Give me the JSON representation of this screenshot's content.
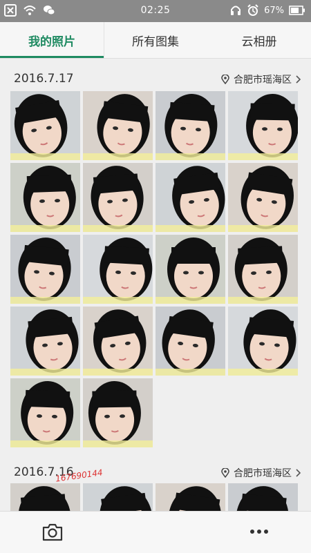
{
  "status_bar": {
    "time": "02:25",
    "battery": "67%",
    "icons_left": [
      "close-box-icon",
      "wifi-icon",
      "wechat-icon"
    ],
    "icons_right": [
      "headset-icon",
      "alarm-icon",
      "battery-icon"
    ]
  },
  "tabs": [
    {
      "label": "我的照片",
      "active": true
    },
    {
      "label": "所有图集",
      "active": false
    },
    {
      "label": "云相册",
      "active": false
    }
  ],
  "sections": [
    {
      "date": "2016.7.17",
      "location": "合肥市瑶海区",
      "photo_count": 18
    },
    {
      "date": "2016.7.16",
      "location": "合肥市瑶海区",
      "photo_count": 4
    }
  ],
  "watermark_text": "167690144",
  "toolbar": {
    "camera_icon": "camera-icon",
    "more_icon": "more-dots-icon"
  },
  "colors": {
    "accent": "#1e8a61",
    "status_bar": "#8a8a8a",
    "background": "#efefef"
  }
}
